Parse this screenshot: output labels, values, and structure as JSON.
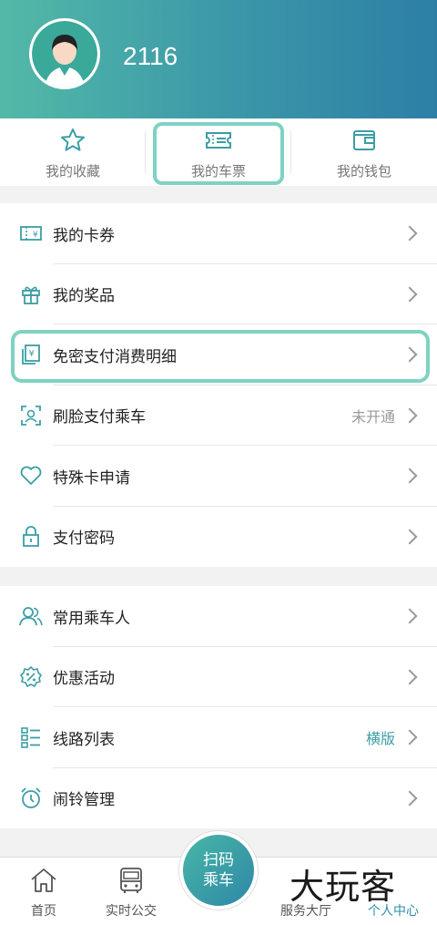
{
  "profile": {
    "username": "2116"
  },
  "quick_actions": [
    {
      "label": "我的收藏",
      "icon": "star-icon"
    },
    {
      "label": "我的车票",
      "icon": "ticket-icon"
    },
    {
      "label": "我的钱包",
      "icon": "wallet-icon"
    }
  ],
  "group1": [
    {
      "label": "我的卡券",
      "icon": "coupon-icon",
      "value": ""
    },
    {
      "label": "我的奖品",
      "icon": "gift-icon",
      "value": ""
    },
    {
      "label": "免密支付消费明细",
      "icon": "yen-receipt-icon",
      "value": ""
    },
    {
      "label": "刷脸支付乘车",
      "icon": "face-scan-icon",
      "value": "未开通"
    },
    {
      "label": "特殊卡申请",
      "icon": "heart-icon",
      "value": ""
    },
    {
      "label": "支付密码",
      "icon": "lock-icon",
      "value": ""
    }
  ],
  "group2": [
    {
      "label": "常用乘车人",
      "icon": "users-icon",
      "value": ""
    },
    {
      "label": "优惠活动",
      "icon": "discount-badge-icon",
      "value": ""
    },
    {
      "label": "线路列表",
      "icon": "list-icon",
      "value": "横版"
    },
    {
      "label": "闹铃管理",
      "icon": "alarm-clock-icon",
      "value": ""
    }
  ],
  "tabbar": {
    "home": "首页",
    "realtime_bus": "实时公交",
    "scan_line1": "扫码",
    "scan_line2": "乘车",
    "service": "服务大厅",
    "personal": "个人中心"
  },
  "watermark": "大玩客",
  "colors": {
    "accent": "#3b9ea4",
    "highlight": "#7fd2c3",
    "header_start": "#53b9a7",
    "header_end": "#2d7fa6"
  }
}
